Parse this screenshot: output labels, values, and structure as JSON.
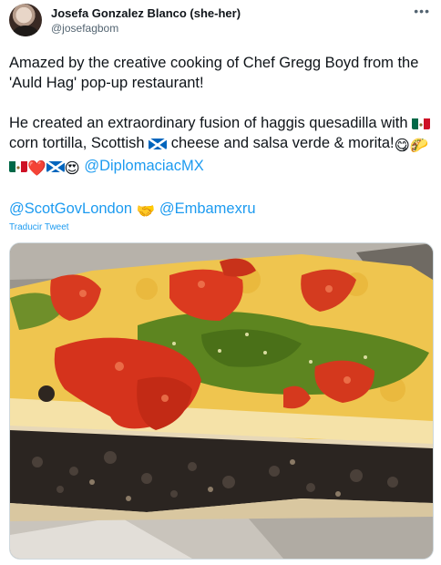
{
  "author": {
    "display_name": "Josefa Gonzalez Blanco (she-her)",
    "handle": "@josefagbom",
    "more_icon": "more-horizontal-icon"
  },
  "tweet": {
    "para1": "Amazed by the creative cooking of Chef Gregg Boyd from the 'Auld Hag' pop-up restaurant!",
    "para2_a": "He created an extraordinary fusion of haggis quesadilla with ",
    "para2_b": " corn tortilla, Scottish ",
    "para2_c": " cheese and salsa verde & morita!",
    "mention_diplomacia": "@DiplomaciacMX",
    "mention_scotgov": "@ScotGovLondon",
    "mention_embamex": "@Embamexru",
    "translate_label": "Traducir Tweet"
  },
  "emojis": {
    "yum": "😋",
    "taco": "🌮",
    "heart": "❤️",
    "heart_eyes": "😍",
    "handshake": "🤝"
  },
  "colors": {
    "mention": "#1d9bf0",
    "secondary_text": "#536471"
  }
}
